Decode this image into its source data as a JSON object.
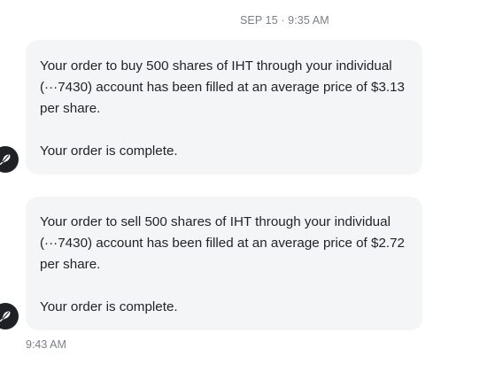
{
  "header": {
    "date_time": "SEP 15 · 9:35 AM"
  },
  "messages": [
    {
      "paragraph": "Your order to buy 500 shares of IHT through your individual (···7430) account has been filled at an average price of $3.13 per share.",
      "status": "Your order is complete.",
      "avatar_icon": "feather-icon"
    },
    {
      "paragraph": "Your order to sell 500 shares of IHT through your individual (···7430) account has been filled at an average price of $2.72 per share.",
      "status": "Your order is complete.",
      "avatar_icon": "feather-icon"
    }
  ],
  "footer": {
    "timestamp": "9:43 AM"
  },
  "colors": {
    "bubble_background": "#f3f5f7",
    "text": "#1f2226",
    "meta_text": "#7b7f86",
    "avatar": "#1f2125"
  }
}
